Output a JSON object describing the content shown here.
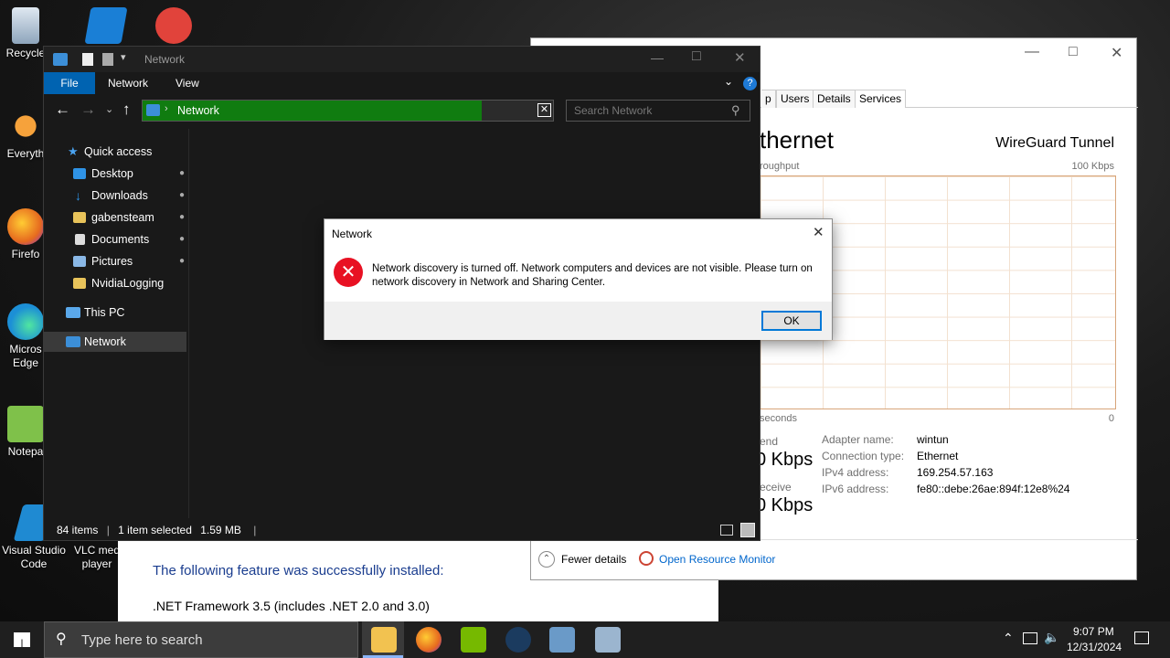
{
  "desktop": {
    "icons": [
      {
        "label": "Recycle",
        "color": "#9fb7cf"
      },
      {
        "label": "Everyth",
        "color": "#f28b1e"
      },
      {
        "label": "Firefo",
        "color": "#e66a1f"
      },
      {
        "label": "Micros Edge",
        "color": "#1c8fd6"
      },
      {
        "label": "Notepa",
        "color": "#58a642"
      },
      {
        "label": "Visual Studio Code",
        "color": "#1f8ad2"
      },
      {
        "label": "VLC med player",
        "color": "#f28c00"
      }
    ]
  },
  "task_manager": {
    "tabs": [
      "p",
      "Users",
      "Details",
      "Services"
    ],
    "adapter_title": "thernet",
    "adapter_name_title": "WireGuard Tunnel",
    "throughput_label": "roughput",
    "max_label": "100 Kbps",
    "seconds_label": "seconds",
    "zero_label": "0",
    "send_label": "end",
    "send_value": "0 Kbps",
    "receive_label": "eceive",
    "receive_value": "0 Kbps",
    "details": [
      {
        "key": "Adapter name:",
        "value": "wintun"
      },
      {
        "key": "Connection type:",
        "value": "Ethernet"
      },
      {
        "key": "IPv4 address:",
        "value": "169.254.57.163"
      },
      {
        "key": "IPv6 address:",
        "value": "fe80::debe:26ae:894f:12e8%24"
      }
    ],
    "fewer_details": "Fewer details",
    "open_resource_monitor": "Open Resource Monitor"
  },
  "installer": {
    "success_text": "The following feature was successfully installed:",
    "feature_text": ".NET Framework 3.5 (includes .NET 2.0 and 3.0)"
  },
  "explorer": {
    "title": "Network",
    "ribbon_tabs": [
      "File",
      "Network",
      "View"
    ],
    "address_path": "Network",
    "search_placeholder": "Search Network",
    "nav": {
      "quick_access": "Quick access",
      "items": [
        "Desktop",
        "Downloads",
        "gabensteam",
        "Documents",
        "Pictures",
        "NvidiaLogging"
      ],
      "this_pc": "This PC",
      "network": "Network"
    },
    "status": {
      "items": "84 items",
      "selected": "1 item selected",
      "size": "1.59 MB"
    }
  },
  "dialog": {
    "title": "Network",
    "message": "Network discovery is turned off. Network computers and devices are not visible. Please turn on network discovery in Network and Sharing Center.",
    "ok_label": "OK"
  },
  "taskbar": {
    "search_placeholder": "Type here to search",
    "time": "9:07 PM",
    "date": "12/31/2024"
  },
  "colors": {
    "accent": "#0078d7",
    "error_red": "#e81123",
    "address_green": "#107c10"
  }
}
